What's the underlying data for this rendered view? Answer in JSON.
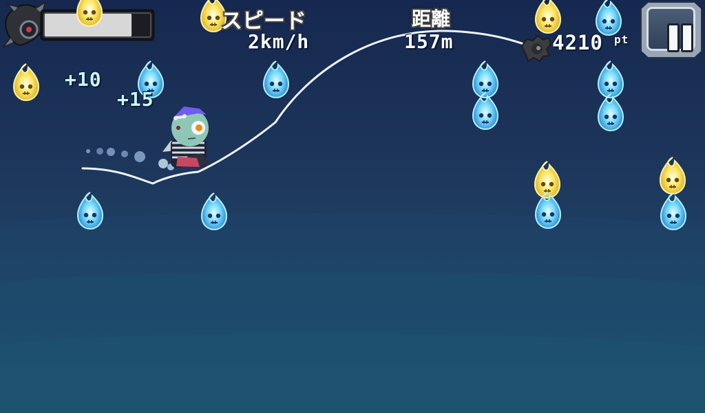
{
  "hud": {
    "speed_label": "スピード",
    "speed_value": "2km/h",
    "distance_label": "距離",
    "distance_value": "157m",
    "points_value": "4210",
    "points_unit": "pt",
    "pause_icon": "pause-icon",
    "health_fraction": 0.82
  },
  "effects": {
    "bonus_1": "+10",
    "bonus_2": "+15"
  },
  "colors": {
    "blue_flame": "#71d7ff",
    "yellow_flame": "#ffe96a",
    "health_fill": "#d7d7d7"
  },
  "icons": {
    "player": "zombie-player-icon",
    "boss": "spiky-boss-icon",
    "flame_blue": "blue-skull-flame-icon",
    "flame_yellow": "yellow-skull-flame-icon"
  }
}
